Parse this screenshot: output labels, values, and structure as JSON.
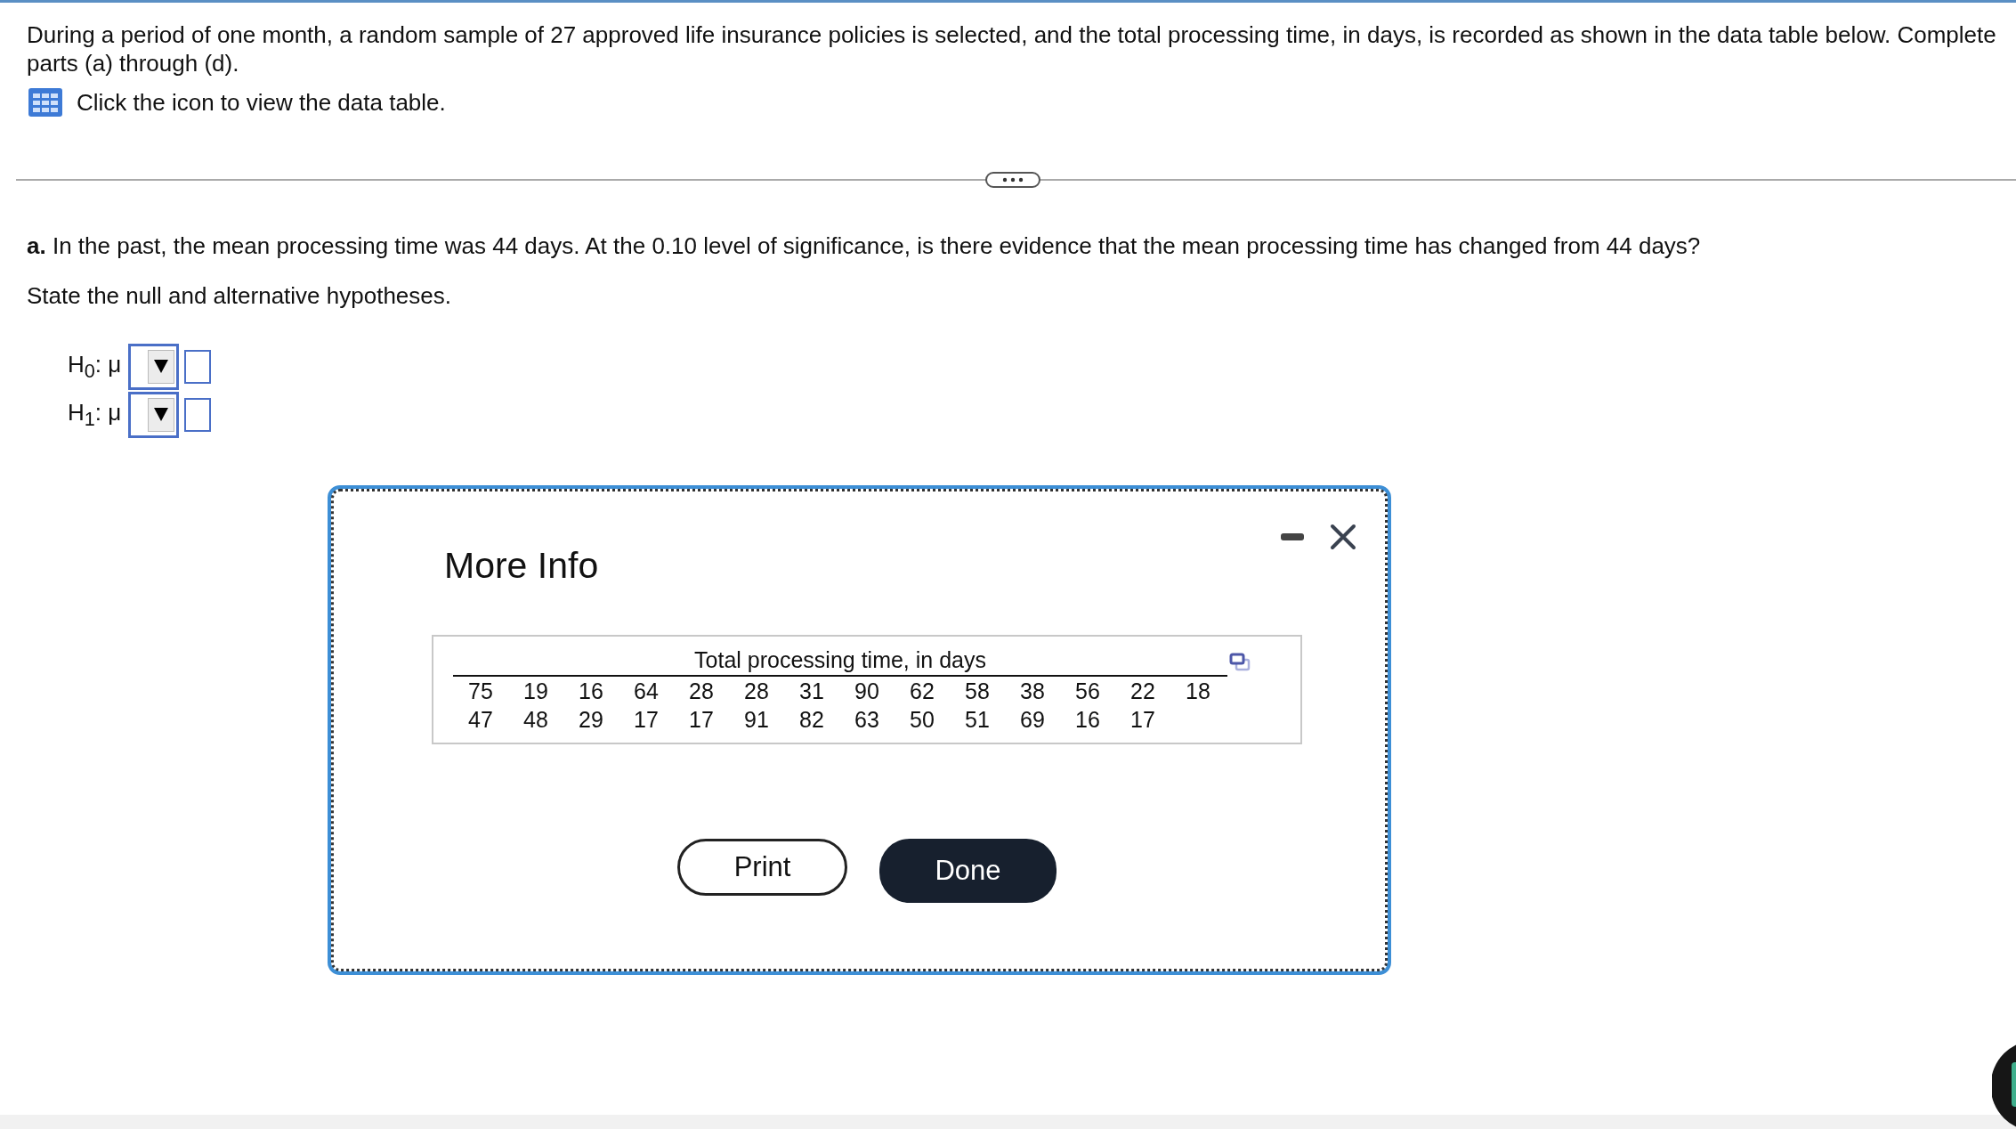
{
  "question": {
    "intro": "During a period of one month, a random sample of 27 approved life insurance policies is selected, and the total processing time, in days, is recorded as shown in the data table below. Complete parts (a) through (d).",
    "data_link": "Click the icon to view the data table.",
    "part_a": "**a.** In the past, the mean processing time was 44 days. At the 0.10 level of significance, is there evidence that the mean processing time has changed from 44 days?",
    "instruction": "State the null and alternative hypotheses.",
    "hypotheses": [
      {
        "label": "H$_{0}$: μ"
      },
      {
        "label": "H$_{1}$: μ"
      }
    ]
  },
  "dialog": {
    "title": "More Info",
    "table": {
      "heading": "Total processing time, in days",
      "rows": [
        [
          "75",
          "19",
          "16",
          "64",
          "28",
          "28",
          "31",
          "90",
          "62",
          "58",
          "38",
          "56",
          "22",
          "18"
        ],
        [
          "47",
          "48",
          "29",
          "17",
          "17",
          "91",
          "82",
          "63",
          "50",
          "51",
          "69",
          "16",
          "17"
        ]
      ]
    },
    "buttons": [
      {
        "label": "Print",
        "kind": "secondary"
      },
      {
        "label": "Done",
        "kind": "primary"
      }
    ]
  }
}
